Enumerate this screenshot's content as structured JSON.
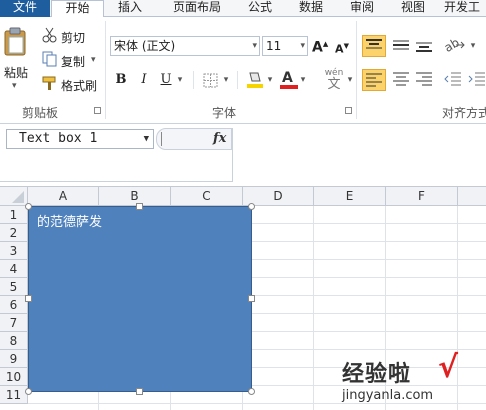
{
  "tabs": [
    "文件",
    "开始",
    "插入",
    "页面布局",
    "公式",
    "数据",
    "审阅",
    "视图",
    "开发工"
  ],
  "ribbon": {
    "clipboard": {
      "paste_label": "粘贴",
      "cut_label": "剪切",
      "copy_label": "复制",
      "format_painter_label": "格式刷",
      "group_label": "剪贴板"
    },
    "font": {
      "font_name": "宋体 (正文)",
      "font_size": "11",
      "bold": "B",
      "italic": "I",
      "underline": "U",
      "font_color_glyph": "A",
      "wen_glyph": "wén",
      "grow_glyph": "A",
      "shrink_glyph": "A",
      "group_label": "字体",
      "fill_color": "#f5d400",
      "font_color": "#e02020"
    },
    "align": {
      "group_label": "对齐方式"
    }
  },
  "formula_bar": {
    "name_box": "Text box 1",
    "fx_label": "fx"
  },
  "grid": {
    "columns": [
      "A",
      "B",
      "C",
      "D",
      "E",
      "F"
    ],
    "rows": [
      "1",
      "2",
      "3",
      "4",
      "5",
      "6",
      "7",
      "8",
      "9",
      "10",
      "11"
    ]
  },
  "textbox": {
    "text": "的范德萨发",
    "fill": "#4f81bd"
  },
  "watermark": {
    "title": "经验啦",
    "check": "√",
    "url": "jingyanla.com"
  }
}
